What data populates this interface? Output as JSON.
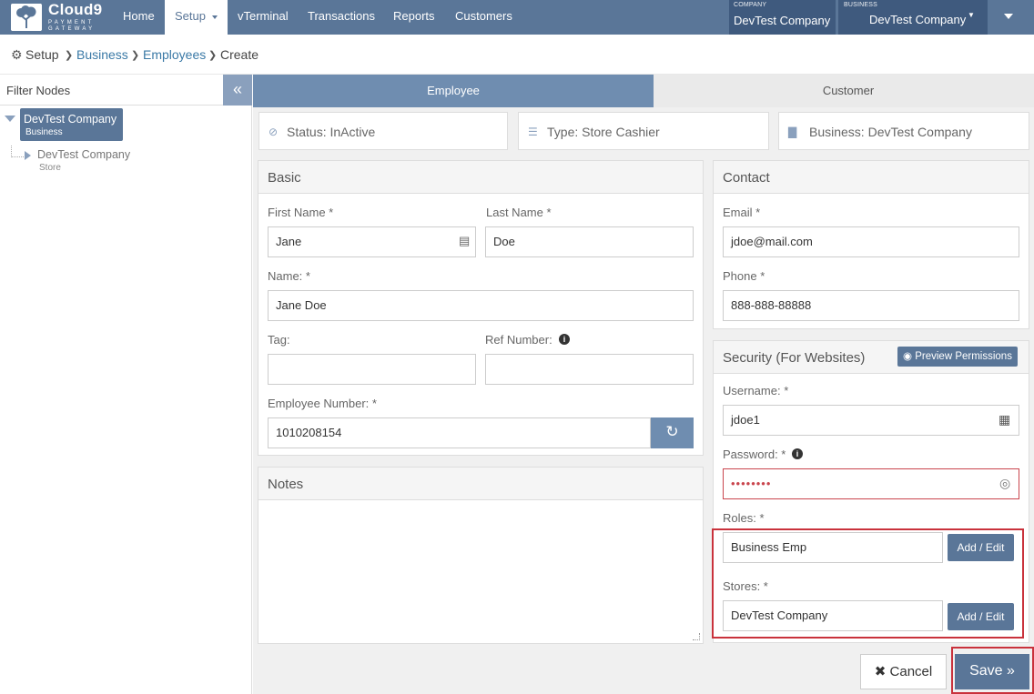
{
  "brand": {
    "name": "Cloud9",
    "tagline1": "PAYMENT",
    "tagline2": "GATEWAY"
  },
  "nav": {
    "items": [
      {
        "label": "Home"
      },
      {
        "label": "Setup"
      },
      {
        "label": "vTerminal"
      },
      {
        "label": "Transactions"
      },
      {
        "label": "Reports"
      },
      {
        "label": "Customers"
      }
    ],
    "active": "Setup"
  },
  "company": {
    "caption": "COMPANY",
    "value": "DevTest Company"
  },
  "business": {
    "caption": "BUSINESS",
    "value": "DevTest Company"
  },
  "breadcrumb": {
    "setup": "Setup",
    "business": "Business",
    "employees": "Employees",
    "create": "Create"
  },
  "sidebar": {
    "filter_label": "Filter Nodes",
    "collapse": "«",
    "tree": [
      {
        "name": "DevTest Company",
        "type": "Business"
      },
      {
        "name": "DevTest Company",
        "type": "Store"
      }
    ]
  },
  "tabs": {
    "employee": "Employee",
    "customer": "Customer"
  },
  "info": {
    "status": "Status: InActive",
    "type": "Type: Store Cashier",
    "business": "Business: DevTest Company"
  },
  "basic": {
    "title": "Basic",
    "first_name_label": "First Name *",
    "first_name": "Jane",
    "last_name_label": "Last Name *",
    "last_name": "Doe",
    "name_label": "Name: *",
    "name": "Jane Doe",
    "tag_label": "Tag:",
    "tag": "",
    "ref_label": "Ref Number:",
    "ref": "",
    "emp_num_label": "Employee Number: *",
    "emp_num": "1010208154",
    "reset_icon": "↻"
  },
  "notes": {
    "title": "Notes",
    "value": ""
  },
  "contact": {
    "title": "Contact",
    "email_label": "Email *",
    "email": "jdoe@mail.com",
    "phone_label": "Phone *",
    "phone": "888-888-88888"
  },
  "security": {
    "title": "Security (For Websites)",
    "preview": "Preview Permissions",
    "username_label": "Username: *",
    "username": "jdoe1",
    "password_label": "Password: *",
    "password": "••••••••",
    "roles_label": "Roles: *",
    "roles": "Business Emp",
    "stores_label": "Stores: *",
    "stores": "DevTest Company",
    "add_edit": "Add / Edit"
  },
  "actions": {
    "cancel": "Cancel",
    "save": "Save »"
  },
  "colors": {
    "primary": "#5a7698",
    "dark": "#3f5a7e",
    "highlight": "#c9323c"
  }
}
